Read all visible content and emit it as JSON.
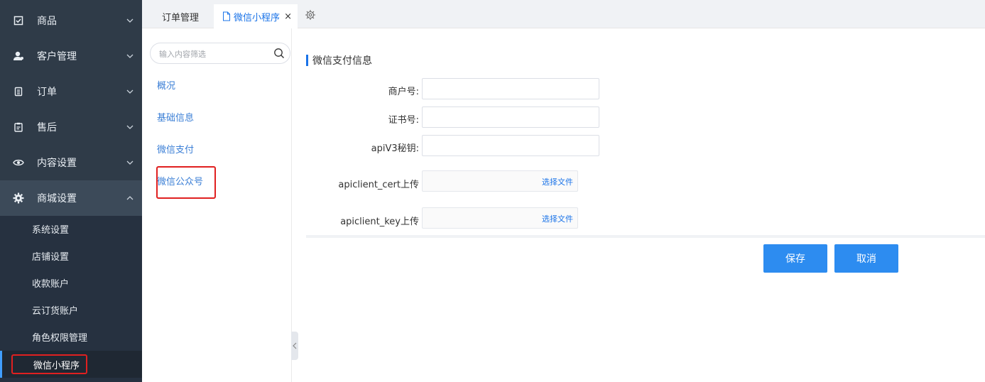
{
  "sidebar": {
    "menu": [
      {
        "label": "商品",
        "icon": "checkbox-icon"
      },
      {
        "label": "客户管理",
        "icon": "user-icon"
      },
      {
        "label": "订单",
        "icon": "document-icon"
      },
      {
        "label": "售后",
        "icon": "clipboard-icon"
      },
      {
        "label": "内容设置",
        "icon": "eye-icon"
      },
      {
        "label": "商城设置",
        "icon": "gear-icon"
      }
    ],
    "submenu": [
      "系统设置",
      "店铺设置",
      "收款账户",
      "云订货账户",
      "角色权限管理",
      "微信小程序"
    ]
  },
  "tabs": {
    "inactive": "订单管理",
    "active": "微信小程序",
    "close": "×"
  },
  "subnav": {
    "search_placeholder": "输入内容筛选",
    "items": [
      "概况",
      "基础信息",
      "微信支付",
      "微信公众号"
    ]
  },
  "form": {
    "section_title": "微信支付信息",
    "merchant_label": "商户号:",
    "cert_no_label": "证书号:",
    "apiv3_label": "apiV3秘钥:",
    "cert_upload_label": "apiclient_cert上传",
    "key_upload_label": "apiclient_key上传",
    "choose_file": "选择文件",
    "merchant_value": "",
    "cert_no_value": "",
    "apiv3_value": ""
  },
  "buttons": {
    "save": "保存",
    "cancel": "取消"
  },
  "colors": {
    "sidebar_bg": "#2f3b48",
    "accent": "#1a73e8",
    "button": "#2d8cf0",
    "highlight_box": "#e02020"
  }
}
